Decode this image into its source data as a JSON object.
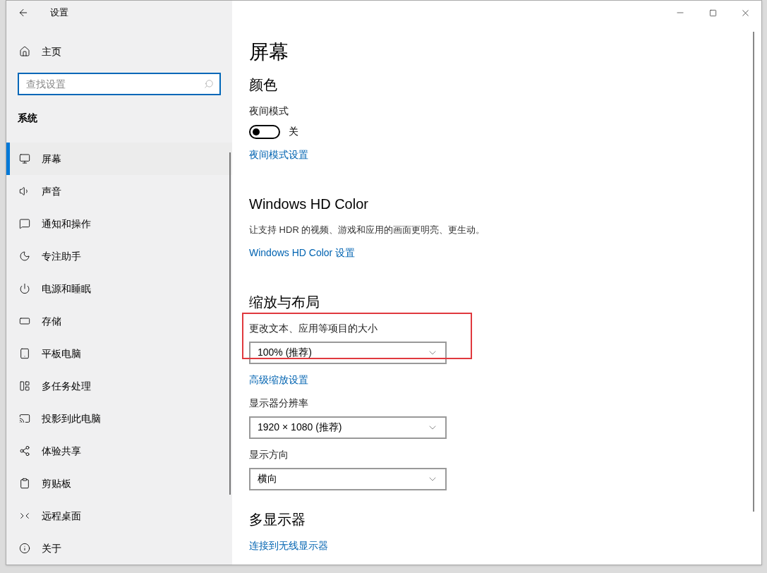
{
  "window": {
    "title": "设置"
  },
  "sidebar": {
    "home": "主页",
    "search": {
      "placeholder": "查找设置"
    },
    "section": "系统",
    "items": [
      {
        "label": "屏幕",
        "selected": true
      },
      {
        "label": "声音",
        "selected": false
      },
      {
        "label": "通知和操作",
        "selected": false
      },
      {
        "label": "专注助手",
        "selected": false
      },
      {
        "label": "电源和睡眠",
        "selected": false
      },
      {
        "label": "存储",
        "selected": false
      },
      {
        "label": "平板电脑",
        "selected": false
      },
      {
        "label": "多任务处理",
        "selected": false
      },
      {
        "label": "投影到此电脑",
        "selected": false
      },
      {
        "label": "体验共享",
        "selected": false
      },
      {
        "label": "剪贴板",
        "selected": false
      },
      {
        "label": "远程桌面",
        "selected": false
      },
      {
        "label": "关于",
        "selected": false
      }
    ]
  },
  "page": {
    "title": "屏幕",
    "sections": [
      {
        "heading": "颜色",
        "items": [
          {
            "kind": "toggle",
            "label": "夜间模式",
            "on": false,
            "state_text": "关"
          },
          {
            "kind": "link",
            "text": "夜间模式设置"
          }
        ]
      },
      {
        "heading": "Windows HD Color",
        "items": [
          {
            "kind": "text",
            "text": "让支持 HDR 的视频、游戏和应用的画面更明亮、更生动。"
          },
          {
            "kind": "link",
            "text": "Windows HD Color 设置"
          }
        ]
      },
      {
        "heading": "缩放与布局",
        "items": [
          {
            "kind": "dropdown",
            "label": "更改文本、应用等项目的大小",
            "value": "100% (推荐)",
            "highlighted": true
          },
          {
            "kind": "link",
            "text": "高级缩放设置"
          },
          {
            "kind": "dropdown",
            "label": "显示器分辨率",
            "value": "1920 × 1080 (推荐)",
            "highlighted": false
          },
          {
            "kind": "dropdown",
            "label": "显示方向",
            "value": "横向",
            "highlighted": false
          }
        ]
      },
      {
        "heading": "多显示器",
        "items": [
          {
            "kind": "link",
            "text": "连接到无线显示器"
          }
        ]
      }
    ]
  }
}
